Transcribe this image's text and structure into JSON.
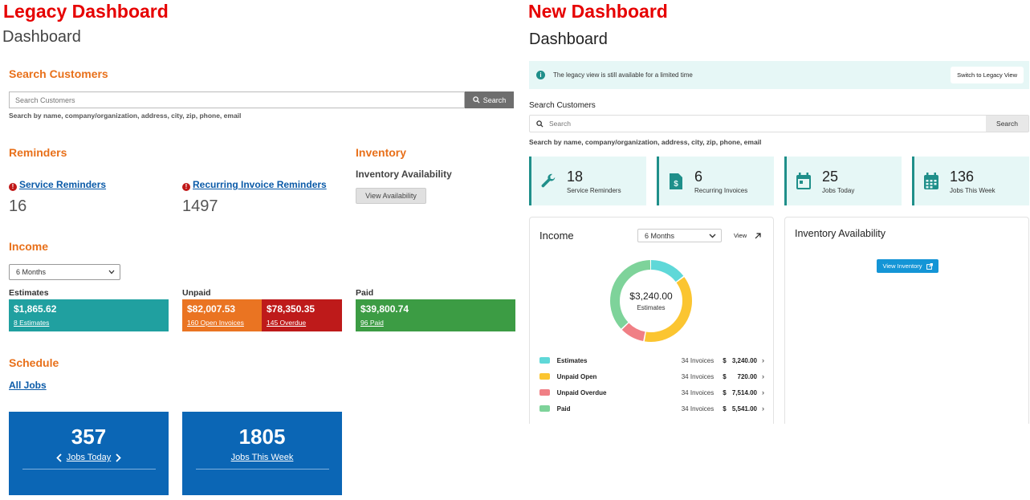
{
  "legacy": {
    "banner": "Legacy Dashboard",
    "title": "Dashboard",
    "search": {
      "heading": "Search Customers",
      "placeholder": "Search Customers",
      "button": "Search",
      "hint": "Search by name, company/organization, address, city, zip, phone, email"
    },
    "reminders": {
      "heading": "Reminders",
      "service_label": "Service Reminders",
      "service_count": "16",
      "recurring_label": "Recurring Invoice Reminders",
      "recurring_count": "1497"
    },
    "inventory": {
      "heading": "Inventory",
      "subheading": "Inventory Availability",
      "button": "View Availability"
    },
    "income": {
      "heading": "Income",
      "period": "6 Months",
      "estimates_label": "Estimates",
      "estimates_amount": "$1,865.62",
      "estimates_sub": "8 Estimates",
      "unpaid_label": "Unpaid",
      "unpaid_open_amount": "$82,007.53",
      "unpaid_open_sub": "160 Open Invoices",
      "unpaid_overdue_amount": "$78,350.35",
      "unpaid_overdue_sub": "145 Overdue",
      "paid_label": "Paid",
      "paid_amount": "$39,800.74",
      "paid_sub": "96 Paid"
    },
    "schedule": {
      "heading": "Schedule",
      "all_jobs": "All Jobs",
      "jobs_today_count": "357",
      "jobs_today_label": "Jobs Today",
      "jobs_week_count": "1805",
      "jobs_week_label": "Jobs This Week"
    },
    "colors": {
      "estimates": "#20a0a0",
      "unpaid_open": "#ea7422",
      "unpaid_overdue": "#be1a1a",
      "paid": "#3c9c44",
      "tiles": "#0b66b5"
    }
  },
  "new": {
    "banner": "New Dashboard",
    "title": "Dashboard",
    "info_text": "The legacy view is still available for a limited time",
    "switch_button": "Switch to Legacy View",
    "search": {
      "heading": "Search Customers",
      "placeholder": "Search",
      "button": "Search",
      "hint": "Search by name, company/organization, address, city, zip, phone, email"
    },
    "stats": [
      {
        "icon": "wrench-icon",
        "value": "18",
        "label": "Service Reminders"
      },
      {
        "icon": "invoice-icon",
        "value": "6",
        "label": "Recurring Invoices"
      },
      {
        "icon": "calendar-icon",
        "value": "25",
        "label": "Jobs Today"
      },
      {
        "icon": "calendar-grid-icon",
        "value": "136",
        "label": "Jobs This Week"
      }
    ],
    "income": {
      "title": "Income",
      "period": "6 Months",
      "view_label": "View",
      "center_value": "$3,240.00",
      "center_label": "Estimates",
      "rows": [
        {
          "name": "Estimates",
          "count": "34 Invoices",
          "currency": "$",
          "amount": "3,240.00",
          "color": "#5fd8d8"
        },
        {
          "name": "Unpaid Open",
          "count": "34 Invoices",
          "currency": "$",
          "amount": "720.00",
          "color": "#fbc531"
        },
        {
          "name": "Unpaid Overdue",
          "count": "34 Invoices",
          "currency": "$",
          "amount": "7,514.00",
          "color": "#f07f85"
        },
        {
          "name": "Paid",
          "count": "34 Invoices",
          "currency": "$",
          "amount": "5,541.00",
          "color": "#7ed39a"
        }
      ],
      "donut_shares": [
        {
          "color": "#5fd8d8",
          "fraction": 0.15
        },
        {
          "color": "#fbc531",
          "fraction": 0.38
        },
        {
          "color": "#f07f85",
          "fraction": 0.1
        },
        {
          "color": "#7ed39a",
          "fraction": 0.37
        }
      ]
    },
    "inventory": {
      "title": "Inventory Availability",
      "button": "View Inventory"
    }
  }
}
